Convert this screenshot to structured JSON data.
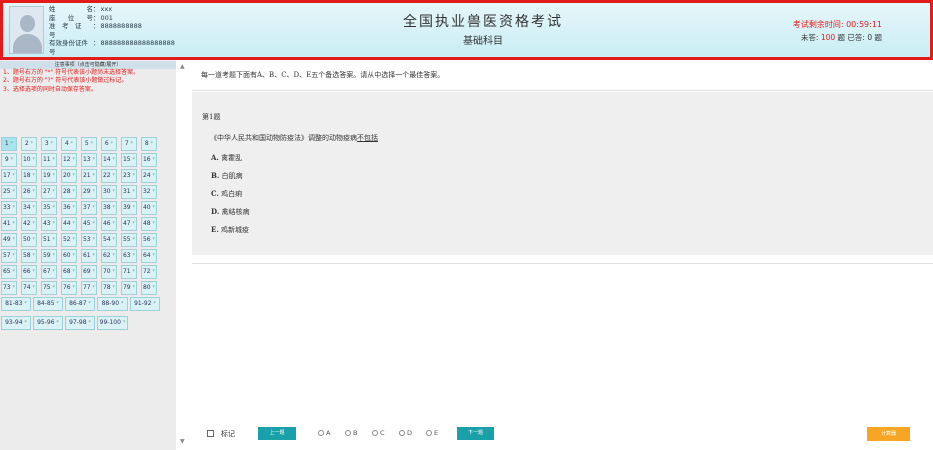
{
  "header": {
    "candidate": [
      {
        "label": "姓　　名",
        "value": "xxx"
      },
      {
        "label": "座　位　号",
        "value": "001"
      },
      {
        "label": "准　考　证　号",
        "value": "8888888888"
      },
      {
        "label": "有效身份证件号",
        "value": "888888888888888888"
      }
    ],
    "title": "全国执业兽医资格考试",
    "subject": "基础科目",
    "timer": "考试剩余时间: 00:59:11",
    "progress_unanswered_label": "未答:",
    "progress_unanswered": "100",
    "progress_rest": "题 已答: 0 题"
  },
  "sidebar": {
    "notice_title": "注意事项（点击可隐藏/展开）",
    "notices": [
      "1、题号右方的 \"*\" 符号代表该小题尚未选择答案。",
      "2、题号右方的 \"?\" 符号代表该小题做过标记。",
      "3、选择选项的同时自动保存答案。"
    ],
    "questions": [
      "1",
      "2",
      "3",
      "4",
      "5",
      "6",
      "7",
      "8",
      "9",
      "10",
      "11",
      "12",
      "13",
      "14",
      "15",
      "16",
      "17",
      "18",
      "19",
      "20",
      "21",
      "22",
      "23",
      "24",
      "25",
      "26",
      "27",
      "28",
      "29",
      "30",
      "31",
      "32",
      "33",
      "34",
      "35",
      "36",
      "37",
      "38",
      "39",
      "40",
      "41",
      "42",
      "43",
      "44",
      "45",
      "46",
      "47",
      "48",
      "49",
      "50",
      "51",
      "52",
      "53",
      "54",
      "55",
      "56",
      "57",
      "58",
      "59",
      "60",
      "61",
      "62",
      "63",
      "64",
      "65",
      "66",
      "67",
      "68",
      "69",
      "70",
      "71",
      "72",
      "73",
      "74",
      "75",
      "76",
      "77",
      "78",
      "79",
      "80"
    ],
    "groups": [
      "81-83",
      "84-85",
      "86-87",
      "88-90",
      "91-92",
      "93-94",
      "95-96",
      "97-98",
      "99-100"
    ],
    "unanswered_mark": "*"
  },
  "main": {
    "instruction": "每一道考题下面有A、B、C、D、E五个备选答案。请从中选择一个最佳答案。",
    "question_number": "第1题",
    "question_text_pre": "《中华人民共和国动物防疫法》调整的动物疫病",
    "question_text_ul": "不包括",
    "options": [
      {
        "letter": "A.",
        "text": "禽霍乱"
      },
      {
        "letter": "B.",
        "text": "白肌病"
      },
      {
        "letter": "C.",
        "text": "鸡白痢"
      },
      {
        "letter": "D.",
        "text": "禽结核病"
      },
      {
        "letter": "E.",
        "text": "鸡新城疫"
      }
    ]
  },
  "bottom": {
    "mark_label": "标记",
    "prev_label": "上一题",
    "next_label": "下一题",
    "answers": [
      "A",
      "B",
      "C",
      "D",
      "E"
    ],
    "calc_label": "计算器"
  }
}
